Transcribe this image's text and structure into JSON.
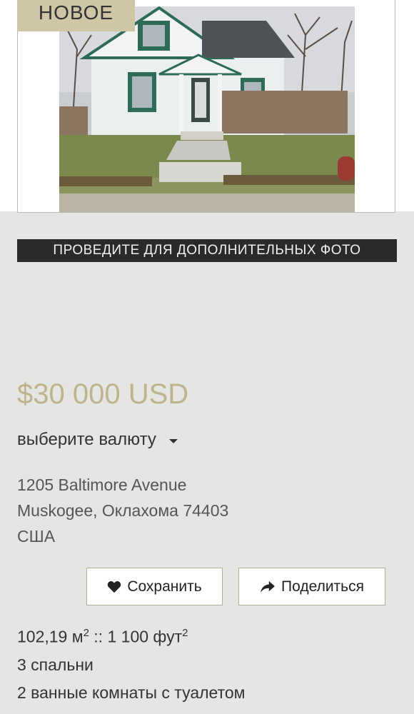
{
  "badge": {
    "label": "НОВОЕ"
  },
  "banner": {
    "label": "ПРОВЕДИТЕ ДЛЯ ДОПОЛНИТЕЛЬНЫХ ФОТО"
  },
  "price": {
    "value": "$30 000 USD"
  },
  "currency": {
    "label": "выберите валюту"
  },
  "address": {
    "street": "1205 Baltimore Avenue",
    "city": "Muskogee, Оклахома 74403",
    "country": "США"
  },
  "actions": {
    "save_label": "Сохранить",
    "share_label": "Поделиться"
  },
  "facts": {
    "area_m": "102,19 м",
    "area_sep": " :: ",
    "area_ft": "1 100 фут",
    "sup": "2",
    "bedrooms": "3 спальни",
    "bathrooms": "2 ванные комнаты с туалетом"
  },
  "colors": {
    "accent": "#bdb38c",
    "badge_bg": "#cfc6a5",
    "banner_bg": "#2a2a2a",
    "page_bg": "#e4e6e3"
  }
}
